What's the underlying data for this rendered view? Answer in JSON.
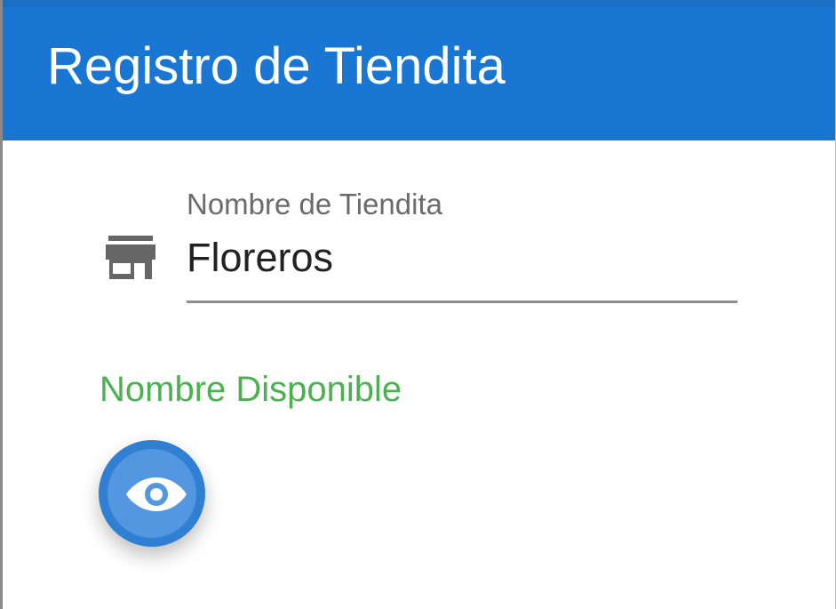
{
  "app_bar": {
    "title": "Registro de Tiendita",
    "color": "#1976d2"
  },
  "form": {
    "store_field": {
      "label": "Nombre de Tiendita",
      "value": "Floreros",
      "icon": "store-icon"
    },
    "status": {
      "text": "Nombre Disponible",
      "color": "#4caf50"
    }
  },
  "fab": {
    "icon": "eye-icon",
    "color": "#2f7fd3"
  }
}
